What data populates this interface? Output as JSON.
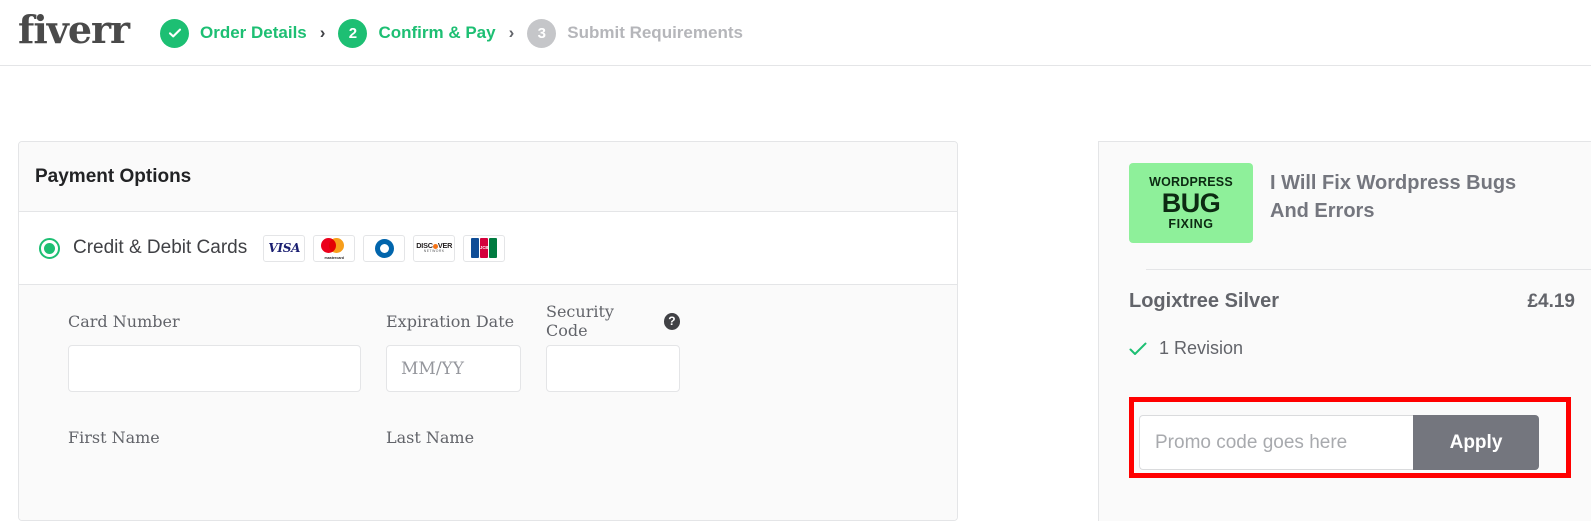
{
  "brand": {
    "logo_text": "fiverr",
    "accent_green": "#1dbf73",
    "gray": "#74767e",
    "annotation_red": "#ff0000"
  },
  "header": {
    "steps": [
      {
        "badge": "check",
        "label": "Order Details",
        "state": "done"
      },
      {
        "badge": "2",
        "label": "Confirm & Pay",
        "state": "active"
      },
      {
        "badge": "3",
        "label": "Submit Requirements",
        "state": "todo"
      }
    ],
    "separator": "›"
  },
  "payment": {
    "panel_title": "Payment Options",
    "option_label": "Credit & Debit Cards",
    "option_selected": true,
    "card_brands": [
      {
        "name": "visa-logo",
        "text": "VISA"
      },
      {
        "name": "mastercard-logo",
        "text": "mastercard"
      },
      {
        "name": "diners-club-logo",
        "text": "Diners Club"
      },
      {
        "name": "discover-logo",
        "text_a": "DISC",
        "text_b": "VER",
        "text_sub": "NETWORK"
      },
      {
        "name": "jcb-logo",
        "text": "JCB"
      }
    ],
    "fields": {
      "card_number": {
        "label": "Card Number",
        "value": "",
        "placeholder": ""
      },
      "expiration_date": {
        "label": "Expiration Date",
        "value": "",
        "placeholder": "MM/YY"
      },
      "security_code": {
        "label": "Security Code",
        "value": "",
        "placeholder": "",
        "help": "?"
      },
      "first_name": {
        "label": "First Name",
        "value": "",
        "placeholder": ""
      },
      "last_name": {
        "label": "Last Name",
        "value": "",
        "placeholder": ""
      }
    }
  },
  "order_summary": {
    "thumbnail": {
      "line1": "WORDPRESS",
      "line2": "BUG",
      "line3": "FIXING",
      "bg": "#8ef09a"
    },
    "gig_title": "I Will Fix Wordpress Bugs And Errors",
    "package_name": "Logixtree Silver",
    "package_price": "£4.19",
    "features": [
      {
        "icon": "check-icon",
        "label": "1 Revision"
      }
    ],
    "promo": {
      "placeholder": "Promo code goes here",
      "value": "",
      "apply_label": "Apply",
      "highlighted": true
    }
  }
}
